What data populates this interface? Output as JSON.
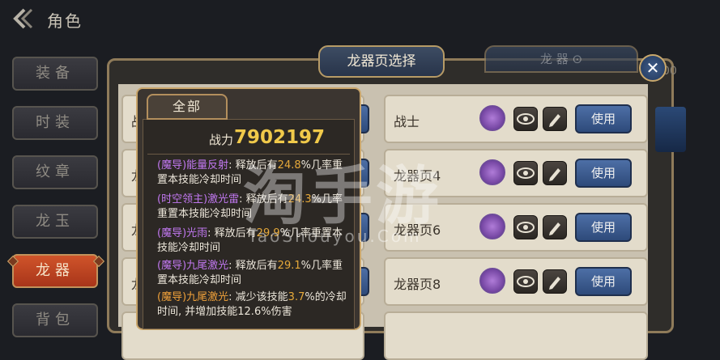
{
  "header": {
    "title": "角色"
  },
  "menu": {
    "items": [
      {
        "label": "装备"
      },
      {
        "label": "时装"
      },
      {
        "label": "纹章"
      },
      {
        "label": "龙玉"
      },
      {
        "label": "龙器"
      },
      {
        "label": "背包"
      }
    ],
    "active_index": 4
  },
  "dialog": {
    "title": "龙器页选择",
    "right_tab_label": "龙 器 ⊙",
    "behind_text": "00"
  },
  "pages": [
    {
      "name": "战士",
      "use_label": "使用"
    },
    {
      "name": "龙器页4",
      "use_label": "使用"
    },
    {
      "name": "龙器页6",
      "use_label": "使用"
    },
    {
      "name": "龙器页8",
      "use_label": "使用"
    }
  ],
  "left_rows": [
    {
      "name": "战"
    },
    {
      "name": "龙"
    },
    {
      "name": "龙"
    },
    {
      "name": "龙"
    }
  ],
  "popup": {
    "tab_label": "全部",
    "power_label": "战力",
    "power_value": "7902197",
    "skills": [
      {
        "name": "(魔导)能量反射",
        "pre": ": 释放后有",
        "pct": "24.8",
        "post": "%几率重置本技能冷却时间",
        "color": "purple"
      },
      {
        "name": "(时空领主)激光雷",
        "pre": ": 释放后有",
        "pct": "24.3",
        "post": "%几率重置本技能冷却时间",
        "color": "purple"
      },
      {
        "name": "(魔导)光雨",
        "pre": ": 释放后有",
        "pct": "29.9",
        "post": "%几率重置本技能冷却时间",
        "color": "purple"
      },
      {
        "name": "(魔导)九尾激光",
        "pre": ": 释放后有",
        "pct": "29.1",
        "post": "%几率重置本技能冷却时间",
        "color": "purple"
      },
      {
        "name": "(魔导)九尾激光",
        "pre": ": 减少该技能",
        "pct": "3.7",
        "post": "%的冷却时间, 并增加技能12.6%伤害",
        "color": "orange"
      }
    ]
  },
  "watermark": {
    "main": "淘手游",
    "sub": "TaoShouyou.Com"
  },
  "colors": {
    "accent_gold": "#f0c94a",
    "active_menu": "#c0482a",
    "skill_purple": "#c178f0",
    "skill_orange": "#f0a13a"
  }
}
